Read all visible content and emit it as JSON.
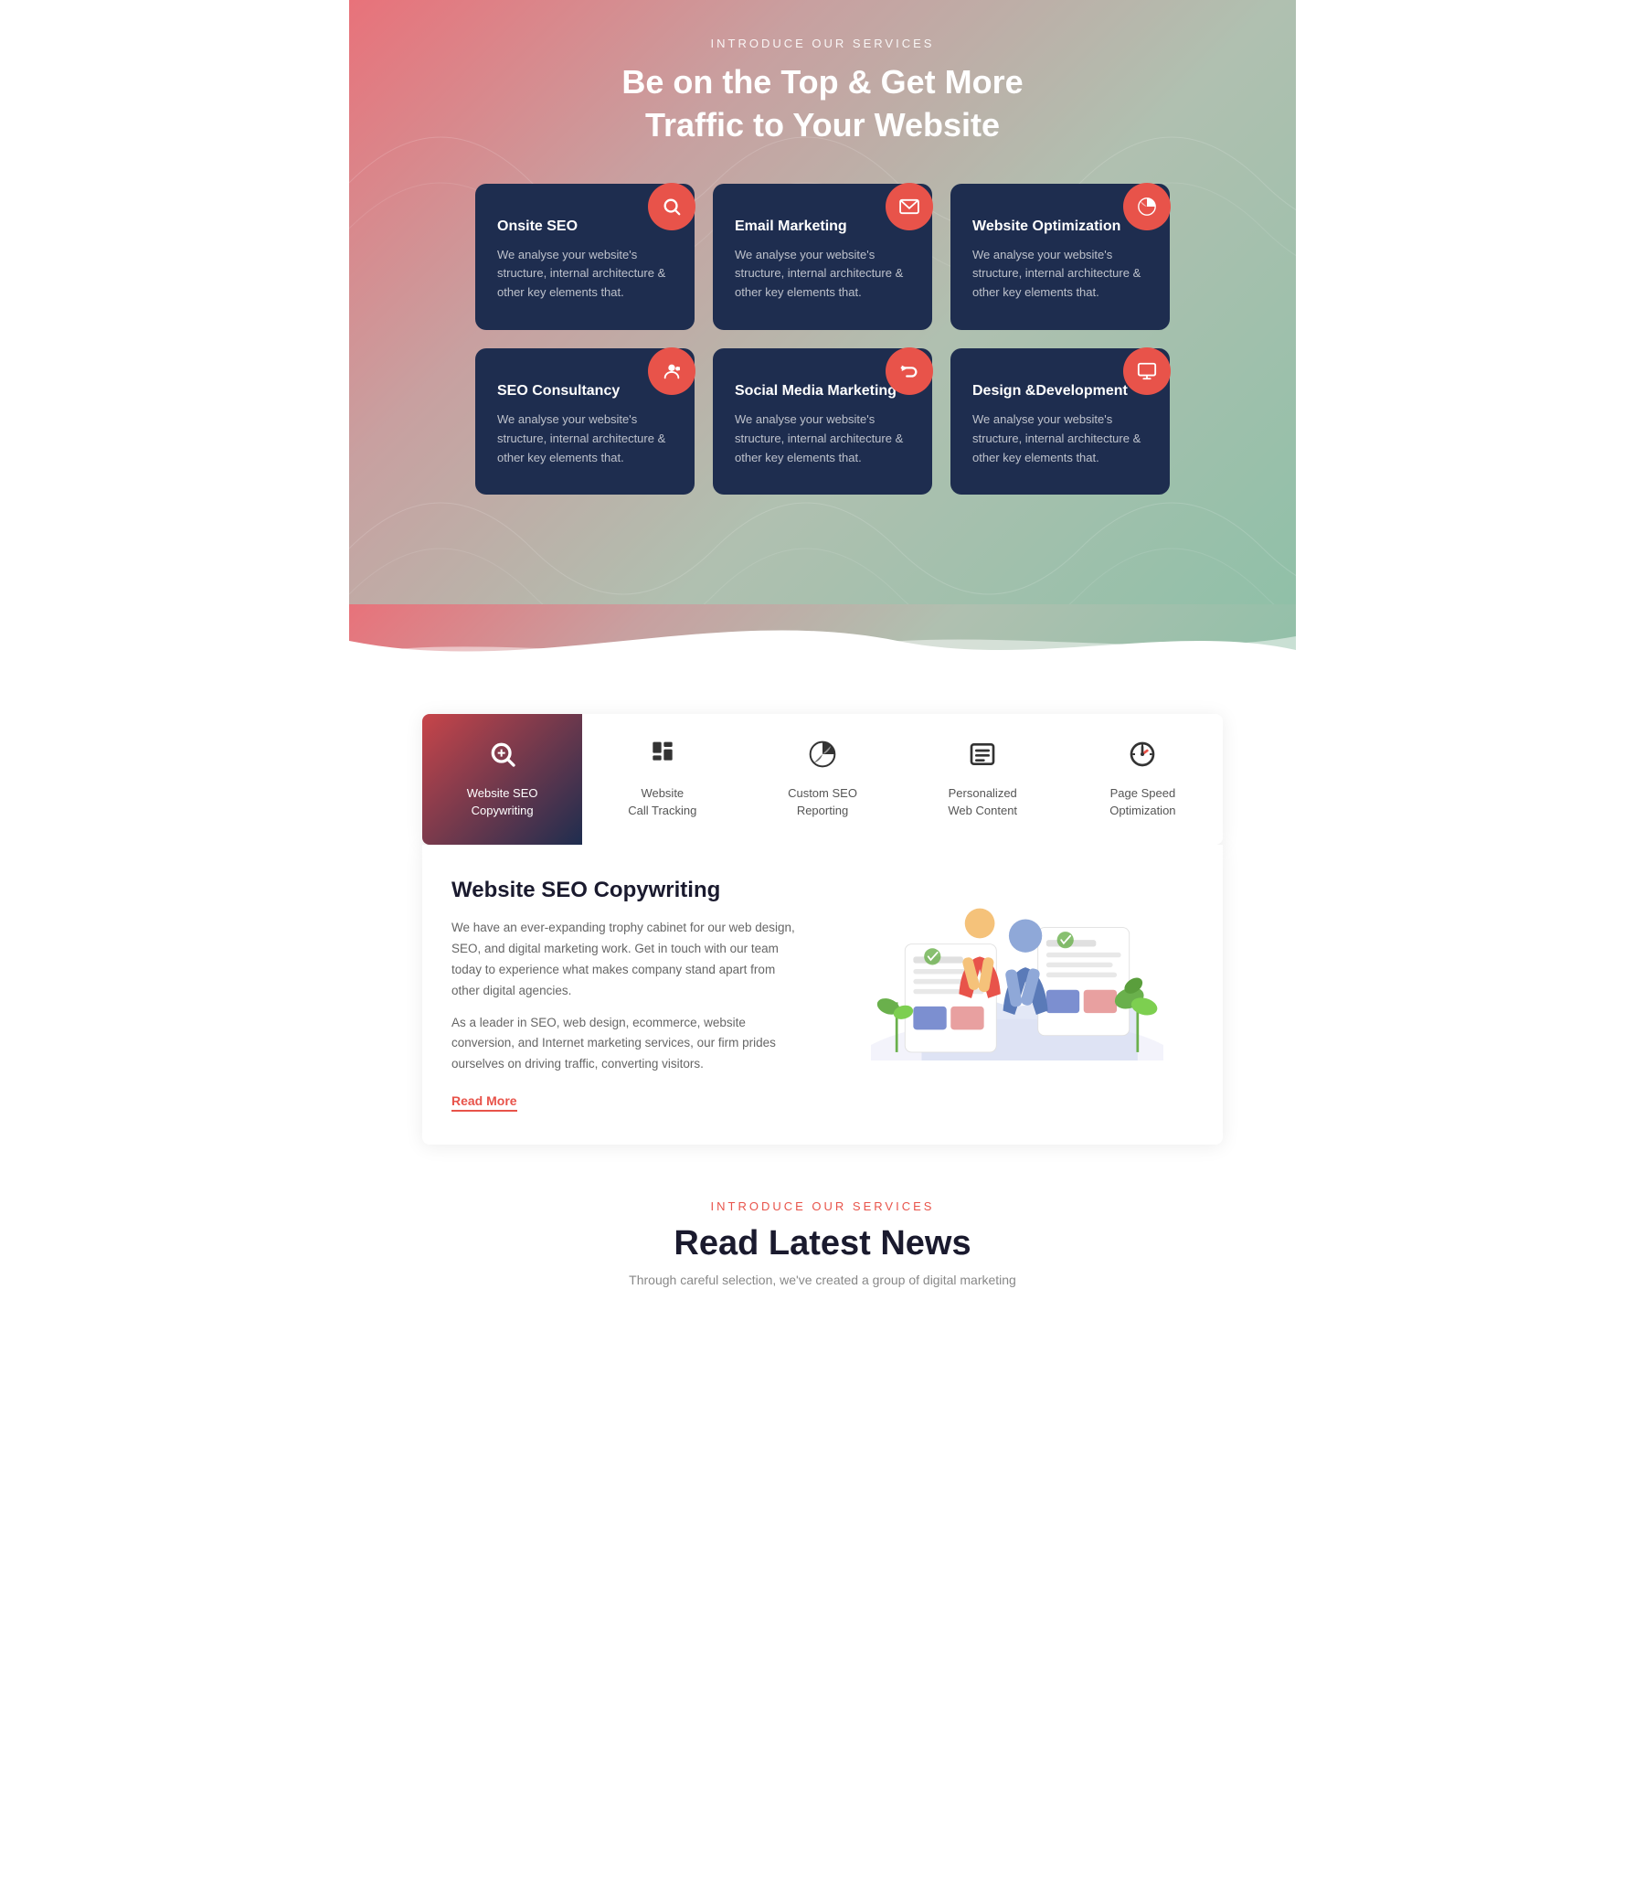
{
  "hero": {
    "label": "INTRODUCE OUR SERVICES",
    "title_line1": "Be on the Top & Get More",
    "title_line2": "Traffic to Your Website",
    "services": [
      {
        "id": "onsite-seo",
        "title": "Onsite SEO",
        "description": "We analyse your website's structure, internal architecture & other key elements that.",
        "icon": "🔍"
      },
      {
        "id": "email-marketing",
        "title": "Email Marketing",
        "description": "We analyse your website's structure, internal architecture & other key elements that.",
        "icon": "✉"
      },
      {
        "id": "website-optimization",
        "title": "Website Optimization",
        "description": "We analyse your website's structure, internal architecture & other key elements that.",
        "icon": "📊"
      },
      {
        "id": "seo-consultancy",
        "title": "SEO Consultancy",
        "description": "We analyse your website's structure, internal architecture & other key elements that.",
        "icon": "👤"
      },
      {
        "id": "social-media",
        "title": "Social Media Marketing",
        "description": "We analyse your website's structure, internal architecture & other key elements that.",
        "icon": "📣"
      },
      {
        "id": "design-dev",
        "title": "Design &Development",
        "description": "We analyse your website's structure, internal architecture & other key elements that.",
        "icon": "🖥"
      }
    ]
  },
  "tabs": {
    "items": [
      {
        "id": "website-seo-copywriting",
        "label_line1": "Website SEO",
        "label_line2": "Copywriting",
        "active": true
      },
      {
        "id": "website-call-tracking",
        "label_line1": "Website",
        "label_line2": "Call Tracking",
        "active": false
      },
      {
        "id": "custom-seo-reporting",
        "label_line1": "Custom SEO",
        "label_line2": "Reporting",
        "active": false
      },
      {
        "id": "personalized-web-content",
        "label_line1": "Personalized",
        "label_line2": "Web Content",
        "active": false
      },
      {
        "id": "page-speed-optimization",
        "label_line1": "Page Speed",
        "label_line2": "Optimization",
        "active": false
      }
    ]
  },
  "content_panel": {
    "title": "Website SEO Copywriting",
    "paragraph1": "We have an ever-expanding trophy cabinet for our web design, SEO, and digital marketing work. Get in touch with our team today to experience what makes company stand apart from other digital agencies.",
    "paragraph2": "As a leader in SEO, web design, ecommerce, website conversion, and Internet marketing services, our firm prides ourselves on driving traffic, converting visitors.",
    "read_more": "Read More"
  },
  "news_section": {
    "label": "INTRODUCE OUR SERVICES",
    "title": "Read Latest News",
    "subtitle": "Through careful selection, we've created a group of digital marketing"
  }
}
